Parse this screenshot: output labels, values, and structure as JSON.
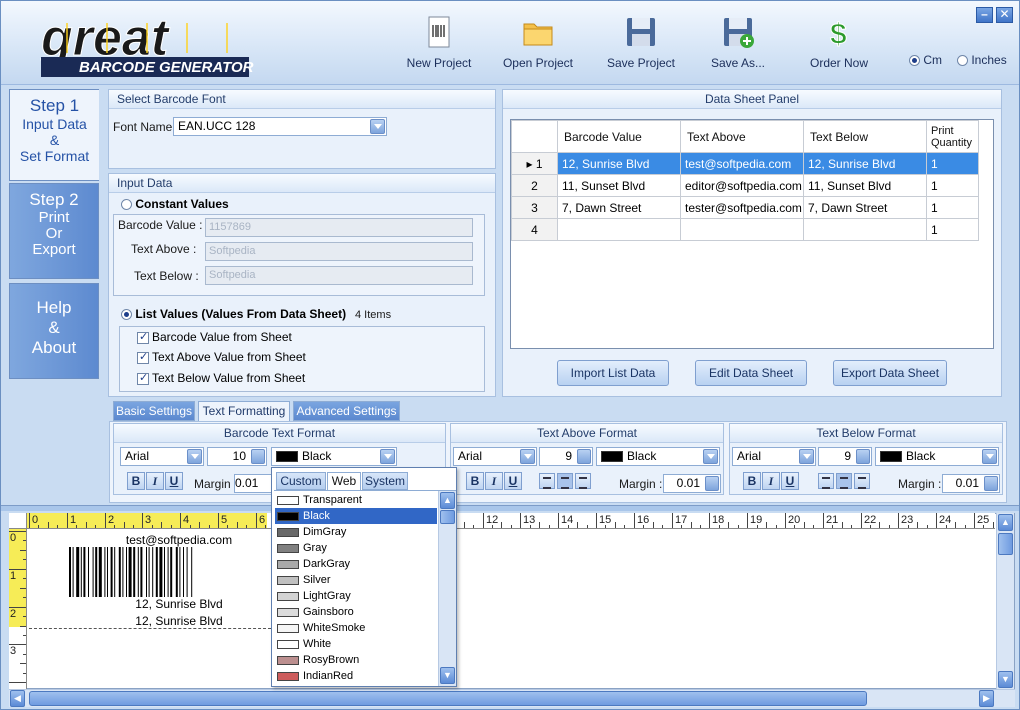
{
  "app": {
    "logo_word": "great",
    "logo_sub": "BARCODE GENERATOR"
  },
  "colors": {
    "accent": "#3167c6",
    "selected_row": "#3a8be4",
    "window_bg": "#c9dcf2"
  },
  "toolbar": {
    "new_project": "New  Project",
    "open_project": "Open  Project",
    "save_project": "Save Project",
    "save_as": "Save As...",
    "order_now": "Order Now",
    "unit_cm": "Cm",
    "unit_inches": "Inches"
  },
  "nav": {
    "step1": {
      "title": "Step 1",
      "line1": "Input Data",
      "line2": "&",
      "line3": "Set Format"
    },
    "step2": {
      "title": "Step 2",
      "line1": "Print",
      "line2": "Or",
      "line3": "Export"
    },
    "help": {
      "line1": "Help",
      "line2": "&",
      "line3": "About"
    }
  },
  "font_panel": {
    "title": "Select Barcode Font",
    "font_name_label": "Font Name:",
    "font_name_value": "EAN.UCC 128"
  },
  "input_panel": {
    "title": "Input Data",
    "constant_label": "Constant Values",
    "barcode_value_label": "Barcode Value :",
    "barcode_value": "1157869",
    "text_above_label": "Text Above :",
    "text_above": "Softpedia",
    "text_below_label": "Text Below :",
    "text_below": "Softpedia",
    "list_label": "List Values (Values From Data Sheet)",
    "items_count": "4 Items",
    "chk_barcode": "Barcode Value from Sheet",
    "chk_above": "Text Above Value from Sheet",
    "chk_below": "Text Below Value from Sheet"
  },
  "data_sheet": {
    "title": "Data Sheet Panel",
    "headers": [
      "Barcode Value",
      "Text Above",
      "Text Below",
      "Print Quantity"
    ],
    "rows": [
      {
        "n": "1",
        "barcode": "12, Sunrise Blvd",
        "above": "test@softpedia.com",
        "below": "12, Sunrise Blvd",
        "qty": "1"
      },
      {
        "n": "2",
        "barcode": "11, Sunset Blvd",
        "above": "editor@softpedia.com",
        "below": "11, Sunset Blvd",
        "qty": "1"
      },
      {
        "n": "3",
        "barcode": "7, Dawn Street",
        "above": "tester@softpedia.com",
        "below": "7, Dawn Street",
        "qty": "1"
      },
      {
        "n": "4",
        "barcode": "",
        "above": "",
        "below": "",
        "qty": "1"
      }
    ],
    "import_button": "Import List Data",
    "edit_button": "Edit Data Sheet",
    "export_button": "Export Data Sheet"
  },
  "tabs": [
    "Basic Settings",
    "Text Formatting",
    "Advanced Settings"
  ],
  "formatting": {
    "barcode_title": "Barcode Text Format",
    "above_title": "Text Above Format",
    "below_title": "Text Below Format",
    "font": "Arial",
    "barcode_size": "10",
    "above_size": "9",
    "below_size": "9",
    "color": "Black",
    "margin_label": "Margin :",
    "barcode_margin": "0.01",
    "above_margin": "0.01",
    "below_margin": "0.01",
    "bold": "B",
    "italic": "I",
    "underline": "U"
  },
  "preview": {
    "text_above": "test@softpedia.com",
    "text_barcode": "12, Sunrise Blvd",
    "text_below": "12, Sunrise Blvd",
    "h_ticks": [
      "0",
      "1",
      "2",
      "3",
      "4",
      "5",
      "6",
      "",
      "",
      "",
      "",
      "",
      "12",
      "13",
      "14",
      "15",
      "16",
      "17",
      "18",
      "19",
      "20",
      "21",
      "22",
      "23",
      "24",
      "25"
    ],
    "v_ticks": [
      "0",
      "1",
      "2",
      "3"
    ]
  },
  "color_popup": {
    "tabs": [
      "Custom",
      "Web",
      "System"
    ],
    "items": [
      {
        "name": "Transparent",
        "hex": "#ffffff"
      },
      {
        "name": "Black",
        "hex": "#000000"
      },
      {
        "name": "DimGray",
        "hex": "#696969"
      },
      {
        "name": "Gray",
        "hex": "#808080"
      },
      {
        "name": "DarkGray",
        "hex": "#a9a9a9"
      },
      {
        "name": "Silver",
        "hex": "#c0c0c0"
      },
      {
        "name": "LightGray",
        "hex": "#d3d3d3"
      },
      {
        "name": "Gainsboro",
        "hex": "#dcdcdc"
      },
      {
        "name": "WhiteSmoke",
        "hex": "#f5f5f5"
      },
      {
        "name": "White",
        "hex": "#ffffff"
      },
      {
        "name": "RosyBrown",
        "hex": "#bc8f8f"
      },
      {
        "name": "IndianRed",
        "hex": "#cd5c5c"
      }
    ],
    "selected": "Black"
  }
}
